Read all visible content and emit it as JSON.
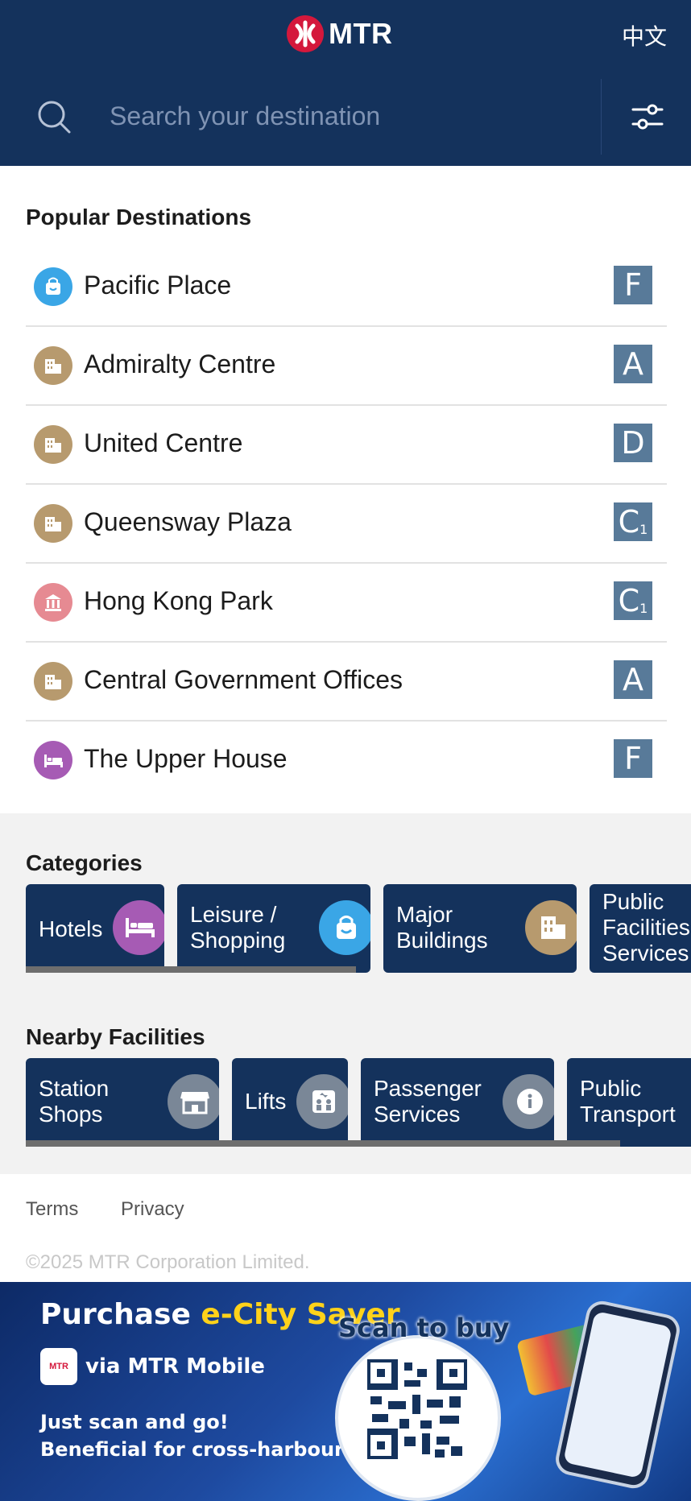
{
  "header": {
    "logo_text": "MTR",
    "language_label": "中文",
    "search_placeholder": "Search your destination",
    "bg_color": "#14325c"
  },
  "popular": {
    "title": "Popular Destinations",
    "items": [
      {
        "name": "Pacific Place",
        "icon": "shopping-bag-icon",
        "icon_color": "#3aa6e6",
        "exit": "F",
        "exit_sub": ""
      },
      {
        "name": "Admiralty Centre",
        "icon": "building-icon",
        "icon_color": "#b79a6e",
        "exit": "A",
        "exit_sub": ""
      },
      {
        "name": "United Centre",
        "icon": "building-icon",
        "icon_color": "#b79a6e",
        "exit": "D",
        "exit_sub": ""
      },
      {
        "name": "Queensway Plaza",
        "icon": "building-icon",
        "icon_color": "#b79a6e",
        "exit": "C",
        "exit_sub": "1"
      },
      {
        "name": "Hong Kong Park",
        "icon": "landmark-icon",
        "icon_color": "#e68a92",
        "exit": "C",
        "exit_sub": "1"
      },
      {
        "name": "Central Government Offices",
        "icon": "building-icon",
        "icon_color": "#b79a6e",
        "exit": "A",
        "exit_sub": ""
      },
      {
        "name": "The Upper House",
        "icon": "bed-icon",
        "icon_color": "#a65bb4",
        "exit": "F",
        "exit_sub": ""
      }
    ]
  },
  "categories": {
    "title": "Categories",
    "items": [
      {
        "label": "Hotels",
        "icon": "bed-icon",
        "icon_color": "#a65bb4"
      },
      {
        "label": "Leisure /\nShopping",
        "icon": "shopping-bag-icon",
        "icon_color": "#3aa6e6"
      },
      {
        "label": "Major\nBuildings",
        "icon": "building-icon",
        "icon_color": "#b79a6e"
      },
      {
        "label": "Public\nFacilities\nServices",
        "icon": "",
        "icon_color": ""
      }
    ]
  },
  "nearby": {
    "title": "Nearby Facilities",
    "items": [
      {
        "label": "Station\nShops",
        "icon": "shop-icon",
        "icon_color": "#7a8797"
      },
      {
        "label": "Lifts",
        "icon": "lift-icon",
        "icon_color": "#7a8797"
      },
      {
        "label": "Passenger\nServices",
        "icon": "info-icon",
        "icon_color": "#7a8797"
      },
      {
        "label": "Public\nTransport",
        "icon": "",
        "icon_color": ""
      }
    ]
  },
  "footer": {
    "terms": "Terms",
    "privacy": "Privacy",
    "copyright": "©2025 MTR Corporation Limited."
  },
  "banner": {
    "title_white": "Purchase ",
    "title_accent": "e-City Saver",
    "mtr_logo_text": "MTR",
    "mtr_line": "via MTR Mobile",
    "line1": "Just scan and go!",
    "line2": "Beneficial for cross-harbour trips!",
    "scan_label": "Scan to buy"
  }
}
